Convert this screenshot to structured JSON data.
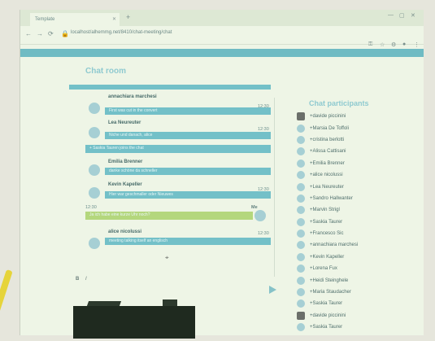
{
  "browser": {
    "tab_title": "Template",
    "url": "localhost/alhemmg.net/8410/chat-meeting/chat",
    "icons": {
      "back": "arrow-left-icon",
      "forward": "arrow-right-icon",
      "reload": "reload-icon",
      "star": "star-icon",
      "extensions": "puzzle-icon",
      "menu": "kebab-menu-icon"
    }
  },
  "page": {
    "title": "Chat room",
    "participants_title": "Chat participants"
  },
  "messages": [
    {
      "sender": "annachiara marchesi",
      "time": "12:30",
      "text": "First was cut in the convert"
    },
    {
      "sender": "Lea Neureuter",
      "time": "12:30",
      "text": "Niche und danach, alice"
    },
    {
      "sender": "",
      "time": "",
      "text": "+ Saskia Tauren joins the chat"
    },
    {
      "sender": "Emilia Brenner",
      "time": "",
      "text": "danke schöne da schneller"
    },
    {
      "sender": "Kevin Kapeller",
      "time": "12:30",
      "text": "Hier war geschmaller oder Nieuwes"
    },
    {
      "sender": "Me",
      "time": "12:30",
      "text": "Ja ich habe eine kurze Uhr noch?"
    },
    {
      "sender": "alice nicolussi",
      "time": "12:30",
      "text": "meeting talking itself an englisch"
    }
  ],
  "participants": [
    {
      "name": "+davide piccinini",
      "photo": true
    },
    {
      "name": "+Marsia De Toffoli",
      "photo": false
    },
    {
      "name": "+cristina berlotti",
      "photo": false
    },
    {
      "name": "+Alissa Cattisani",
      "photo": false
    },
    {
      "name": "+Emilia Brenner",
      "photo": false
    },
    {
      "name": "+alice nicolussi",
      "photo": false
    },
    {
      "name": "+Lea Neureuter",
      "photo": false
    },
    {
      "name": "+Sandro Hallwanter",
      "photo": false
    },
    {
      "name": "+Marvin Strigl",
      "photo": false
    },
    {
      "name": "+Saskia Taurer",
      "photo": false
    },
    {
      "name": "+Francesco Sic",
      "photo": false
    },
    {
      "name": "+annachiara marchesi",
      "photo": false
    },
    {
      "name": "+Kevin Kapeller",
      "photo": false
    },
    {
      "name": "+Lorena Fux",
      "photo": false
    },
    {
      "name": "+Heidi Steinghele",
      "photo": false
    },
    {
      "name": "+Maria Staudacher",
      "photo": false
    },
    {
      "name": "+Saskia Taurer",
      "photo": false
    },
    {
      "name": "+davide piccinini",
      "photo": true
    },
    {
      "name": "+Saskia Taurer",
      "photo": false
    }
  ],
  "editor": {
    "bold": "B",
    "italic": "I"
  },
  "colors": {
    "accent": "#73c0c8",
    "me_bubble": "#b4d77d",
    "title": "#8fcad0"
  }
}
